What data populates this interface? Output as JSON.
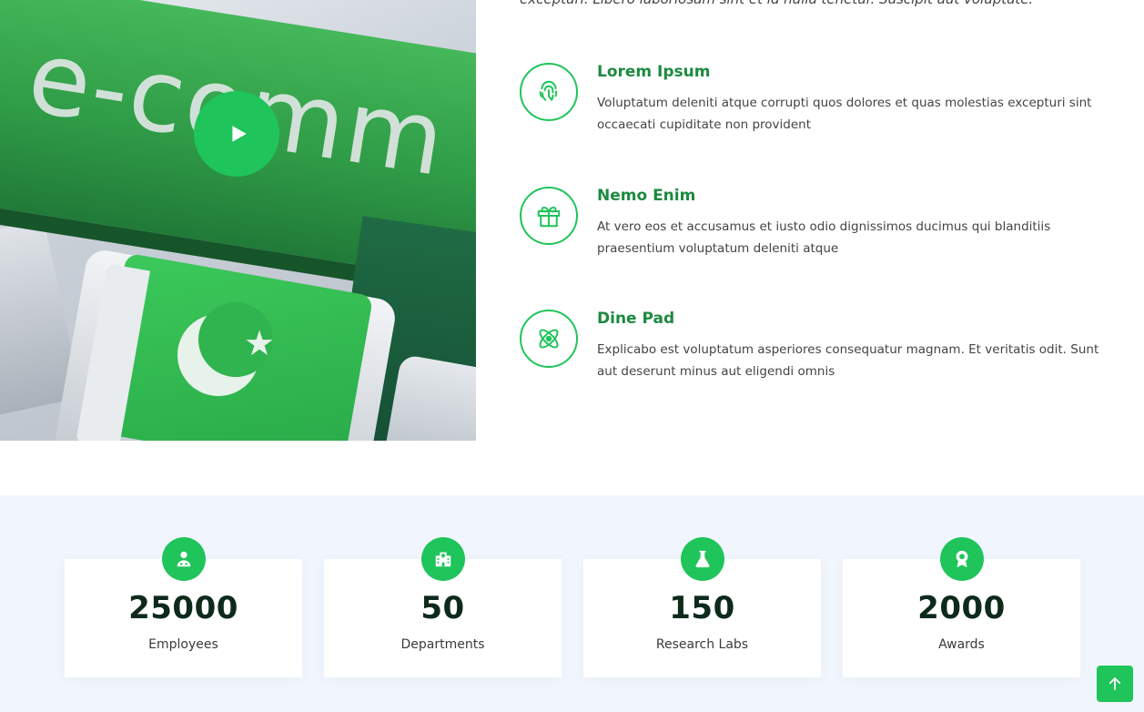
{
  "about": {
    "intro_text": "excepturi. Libero laboriosam sint et id nulla tenetur. Suscipit aut voluptate.",
    "video": {
      "image_text": "e-comm",
      "play_icon": "play-icon"
    },
    "features": [
      {
        "icon": "fingerprint-icon",
        "title": "Lorem Ipsum",
        "description": "Voluptatum deleniti atque corrupti quos dolores et quas molestias excepturi sint occaecati cupiditate non provident"
      },
      {
        "icon": "gift-icon",
        "title": "Nemo Enim",
        "description": "At vero eos et accusamus et iusto odio dignissimos ducimus qui blanditiis praesentium voluptatum deleniti atque"
      },
      {
        "icon": "atom-icon",
        "title": "Dine Pad",
        "description": "Explicabo est voluptatum asperiores consequatur magnam. Et veritatis odit. Sunt aut deserunt minus aut eligendi omnis"
      }
    ]
  },
  "counts": [
    {
      "icon": "doctor-icon",
      "value": "25000",
      "label": "Employees"
    },
    {
      "icon": "hospital-icon",
      "value": "50",
      "label": "Departments"
    },
    {
      "icon": "flask-icon",
      "value": "150",
      "label": "Research Labs"
    },
    {
      "icon": "award-icon",
      "value": "2000",
      "label": "Awards"
    }
  ],
  "back_to_top": {
    "icon": "arrow-up-icon"
  },
  "colors": {
    "accent": "#1fc45a",
    "title_green": "#1d8a40",
    "counts_bg": "#f1f6fe",
    "number_color": "#0e2a1b"
  }
}
